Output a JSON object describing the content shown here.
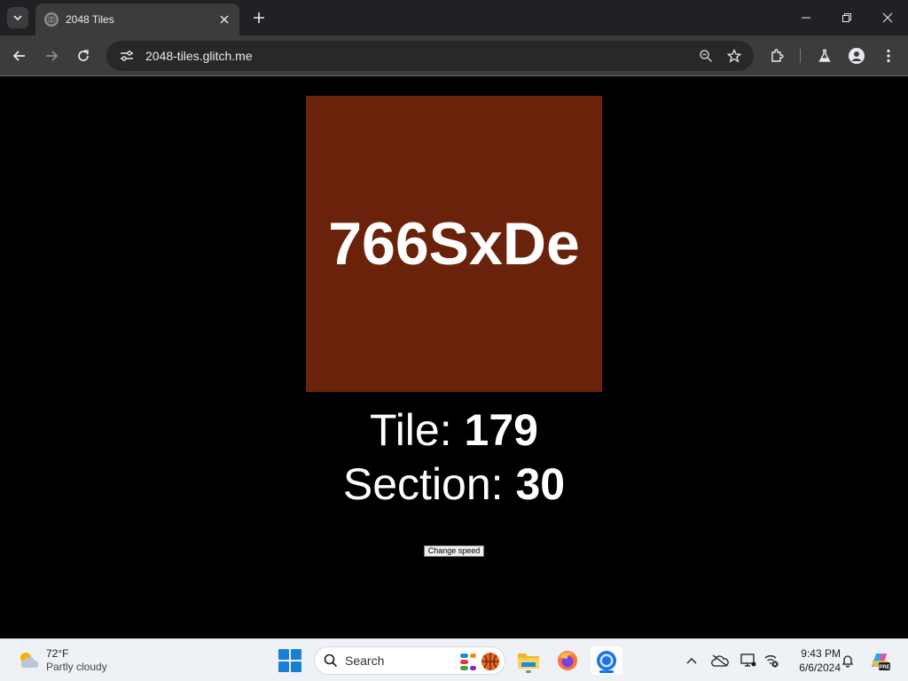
{
  "browser": {
    "tab_title": "2048 Tiles",
    "url": "2048-tiles.glitch.me"
  },
  "page": {
    "tile_code": "766SxDe",
    "tile_color": "#6b220a",
    "tile_label": "Tile:",
    "tile_number": "179",
    "section_label": "Section:",
    "section_number": "30",
    "change_speed_label": "Change speed"
  },
  "taskbar": {
    "weather_temp": "72°F",
    "weather_condition": "Partly cloudy",
    "search_placeholder": "Search",
    "time": "9:43 PM",
    "date": "6/6/2024"
  },
  "icons": [
    "tab-list-icon",
    "globe-icon",
    "close-icon",
    "plus-icon",
    "minimize-icon",
    "restore-icon",
    "back-icon",
    "forward-icon",
    "reload-icon",
    "site-info-icon",
    "zoom-icon",
    "star-icon",
    "extensions-icon",
    "labs-icon",
    "profile-icon",
    "menu-icon",
    "weather-icon",
    "windows-start-icon",
    "search-icon",
    "copilot-widget-icon",
    "file-explorer-icon",
    "firefox-icon",
    "chrome-icon",
    "chevron-up-icon",
    "onedrive-icon",
    "display-icon",
    "network-icon",
    "bell-icon",
    "copilot-icon"
  ]
}
